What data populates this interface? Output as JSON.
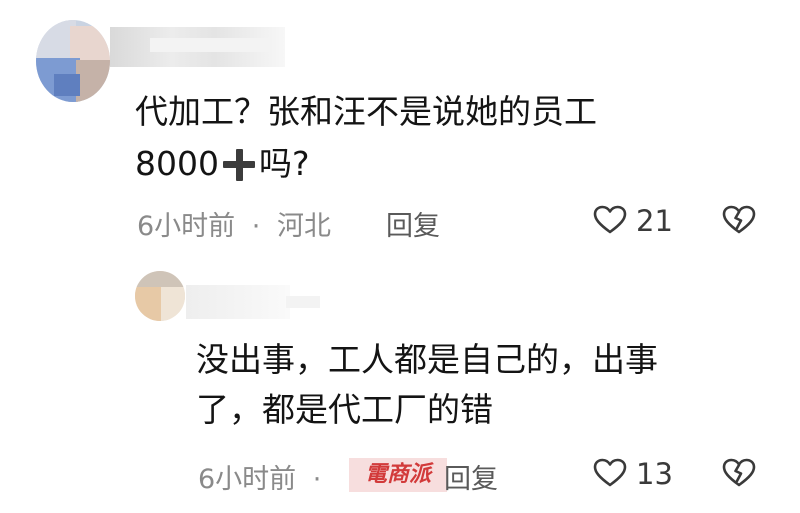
{
  "comments": [
    {
      "text_line1": "代加工？张和汪不是说她的员工",
      "text_line2_before": "8000",
      "text_line2_after": "吗?",
      "time": "6小时前",
      "location": "河北",
      "reply_label": "回复",
      "likes": "21"
    },
    {
      "text_line1": "没出事，工人都是自己的，出事",
      "text_line2": "了，都是代工厂的错",
      "time": "6小时前",
      "separator": "·",
      "reply_label": "回复",
      "likes": "13"
    }
  ],
  "meta_separator": "·",
  "watermark": "電商派",
  "icons": [
    "plus-emoji-icon",
    "heart-outline-icon",
    "broken-heart-icon"
  ]
}
